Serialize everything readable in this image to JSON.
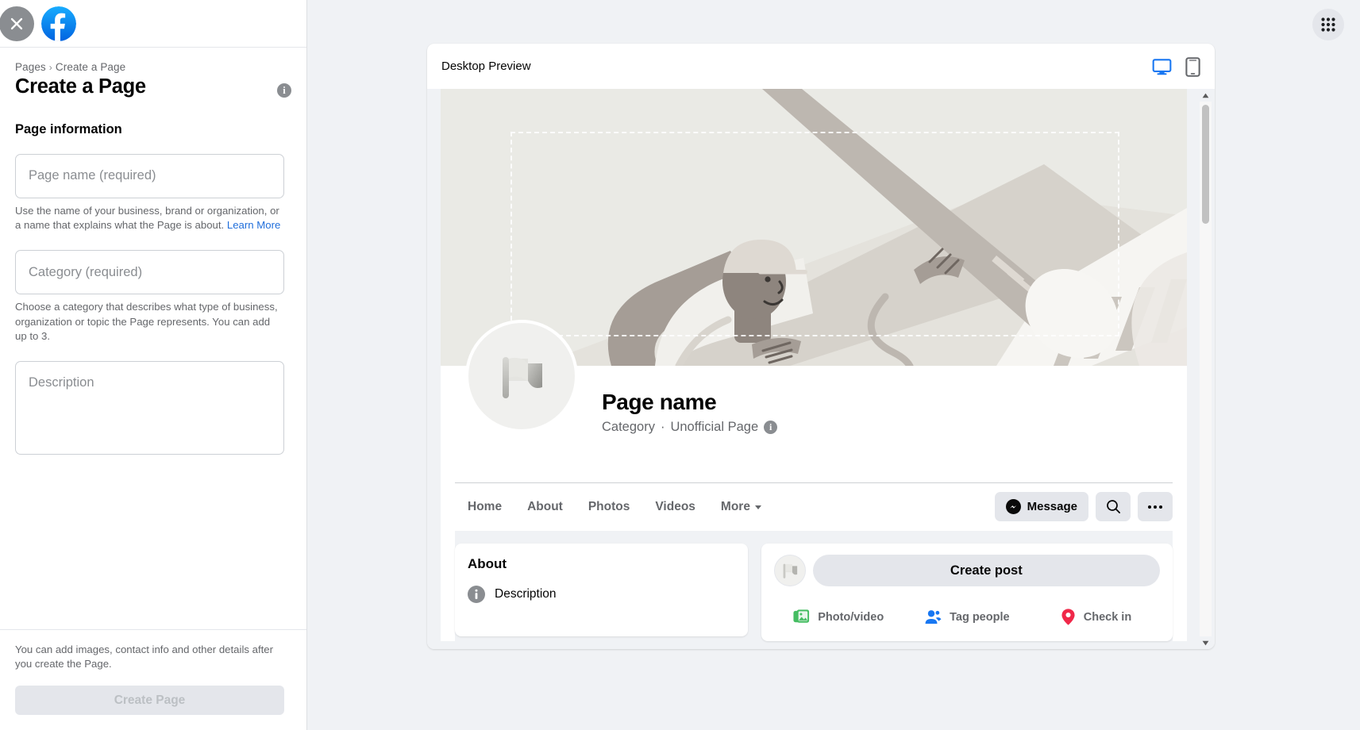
{
  "sidebar": {
    "close_icon": "close-icon",
    "logo_icon": "facebook-logo",
    "breadcrumb": {
      "root": "Pages",
      "separator": "›",
      "current": "Create a Page"
    },
    "title": "Create a Page",
    "info_icon": "i",
    "section_label": "Page information",
    "fields": [
      {
        "name": "page-name",
        "placeholder": "Page name (required)",
        "helper": "Use the name of your business, brand or organization, or a name that explains what the Page is about.",
        "helper_link": "Learn More"
      },
      {
        "name": "category",
        "placeholder": "Category (required)",
        "helper": "Choose a category that describes what type of business, organization or topic the Page represents. You can add up to 3.",
        "helper_link": ""
      },
      {
        "name": "description",
        "placeholder": "Description",
        "helper": "",
        "helper_link": ""
      }
    ],
    "footer_note": "You can add images, contact info and other details after you create the Page.",
    "create_button": "Create Page"
  },
  "topbar": {
    "grid_icon": "apps-grid-icon"
  },
  "preview": {
    "title": "Desktop Preview",
    "toggles": [
      {
        "name": "desktop",
        "icon": "desktop-monitor-icon",
        "active": true
      },
      {
        "name": "mobile",
        "icon": "mobile-phone-icon",
        "active": false
      }
    ],
    "page": {
      "name": "Page name",
      "category": "Category",
      "unofficial": "Unofficial Page",
      "info_icon": "i",
      "avatar_icon": "flag-placeholder-icon",
      "nav_tabs": [
        {
          "label": "Home",
          "has_caret": false
        },
        {
          "label": "About",
          "has_caret": false
        },
        {
          "label": "Photos",
          "has_caret": false
        },
        {
          "label": "Videos",
          "has_caret": false
        },
        {
          "label": "More",
          "has_caret": true
        }
      ],
      "actions": {
        "message_label": "Message",
        "message_icon": "messenger-icon",
        "search_icon": "search-icon",
        "more_icon": "ellipsis-icon"
      },
      "about_card": {
        "title": "About",
        "icon": "info-icon",
        "description": "Description"
      },
      "composer": {
        "avatar_icon": "flag-placeholder-icon",
        "placeholder": "Create post",
        "actions": [
          {
            "label": "Photo/video",
            "icon": "photo-video-icon",
            "color": "#45bd62"
          },
          {
            "label": "Tag people",
            "icon": "tag-people-icon",
            "color": "#1877f2"
          },
          {
            "label": "Check in",
            "icon": "location-pin-icon",
            "color": "#f02849"
          }
        ]
      }
    }
  },
  "colors": {
    "facebook_blue": "#1877f2",
    "page_bg": "#f0f2f5",
    "cover_bg": "#eaeae5",
    "disabled_btn": "#e4e6eb"
  }
}
